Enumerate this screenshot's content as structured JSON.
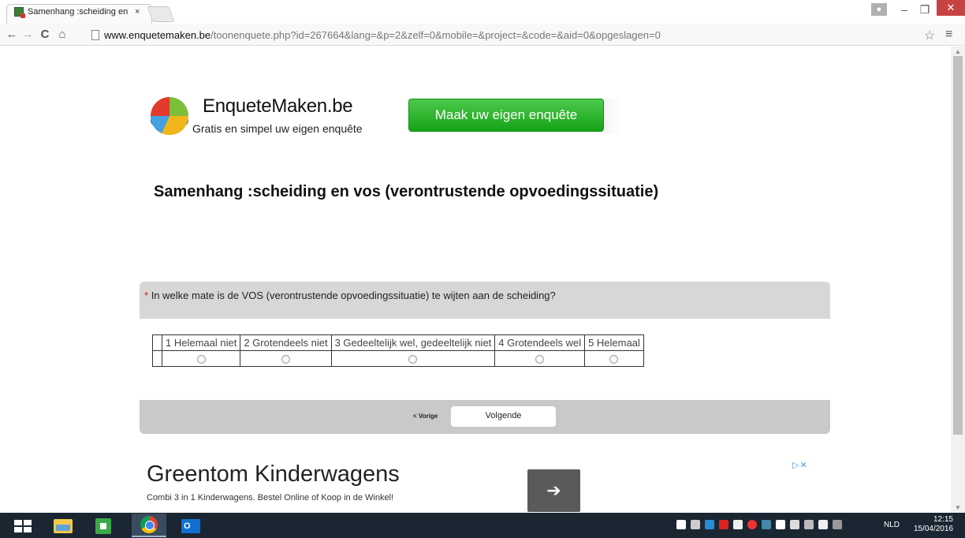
{
  "browser": {
    "tab_title": "Samenhang :scheiding en",
    "tab_close": "×",
    "url_host": "www.enquetemaken.be",
    "url_path": "/toonenquete.php?id=267664&lang=&p=2&zelf=0&mobile=&project=&code=&aid=0&opgeslagen=0",
    "window_min": "–",
    "window_max": "❐",
    "window_close": "✕"
  },
  "header": {
    "logo_name": "EnqueteMaken.be",
    "logo_tagline": "Gratis en simpel uw eigen enquête",
    "cta_label": "Maak uw eigen enquête"
  },
  "survey": {
    "title": "Samenhang :scheiding en vos (verontrustende opvoedingssituatie)",
    "required_mark": "*",
    "question": "In welke mate is de VOS (verontrustende opvoedingssituatie) te wijten aan de scheiding?",
    "options": [
      "1 Helemaal niet",
      "2 Grotendeels niet",
      "3 Gedeeltelijk wel, gedeeltelijk niet",
      "4 Grotendeels wel",
      "5 Helemaal"
    ],
    "prev_label": "< Vorige",
    "next_label": "Volgende"
  },
  "ad": {
    "title": "Greentom Kinderwagens",
    "description": "Combi 3 in 1 Kinderwagens. Bestel Online of Koop in de Winkel!",
    "choices": "▷✕"
  },
  "taskbar": {
    "language": "NLD",
    "time": "12:15",
    "date": "15/04/2016"
  },
  "colors": {
    "cta_green": "#16a316",
    "question_gray": "#d7d7d7",
    "nav_gray": "#c9c9c9",
    "required_red": "#d61e1e",
    "taskbar": "#1b2633"
  }
}
